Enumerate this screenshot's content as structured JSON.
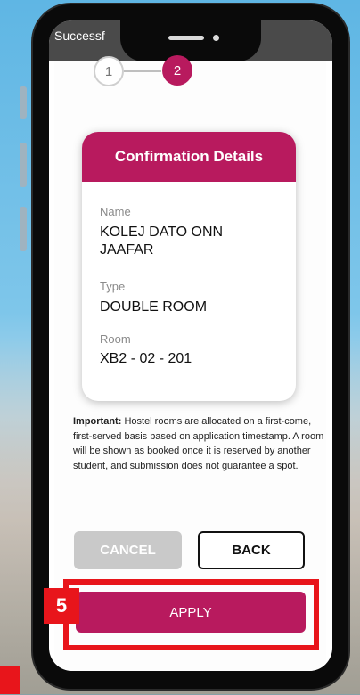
{
  "status_bar": {
    "title": "Successf"
  },
  "stepper": {
    "steps": [
      "1",
      "2"
    ],
    "active_step": "2"
  },
  "confirmation": {
    "header": "Confirmation Details",
    "name_label": "Name",
    "name_value": "KOLEJ DATO ONN JAAFAR",
    "type_label": "Type",
    "type_value": "DOUBLE ROOM",
    "room_label": "Room",
    "room_value": "XB2 - 02 - 201"
  },
  "note": {
    "bold": "Important:",
    "text": " Hostel rooms are allocated on a first-come, first-served basis based on application timestamp. A room will be shown as booked once it is reserved by another student, and submission does not guarantee a spot."
  },
  "buttons": {
    "cancel": "CANCEL",
    "back": "BACK",
    "apply": "APPLY"
  },
  "tutorial": {
    "step_number": "5"
  },
  "colors": {
    "accent": "#b81a5e",
    "highlight": "#e8151b"
  }
}
